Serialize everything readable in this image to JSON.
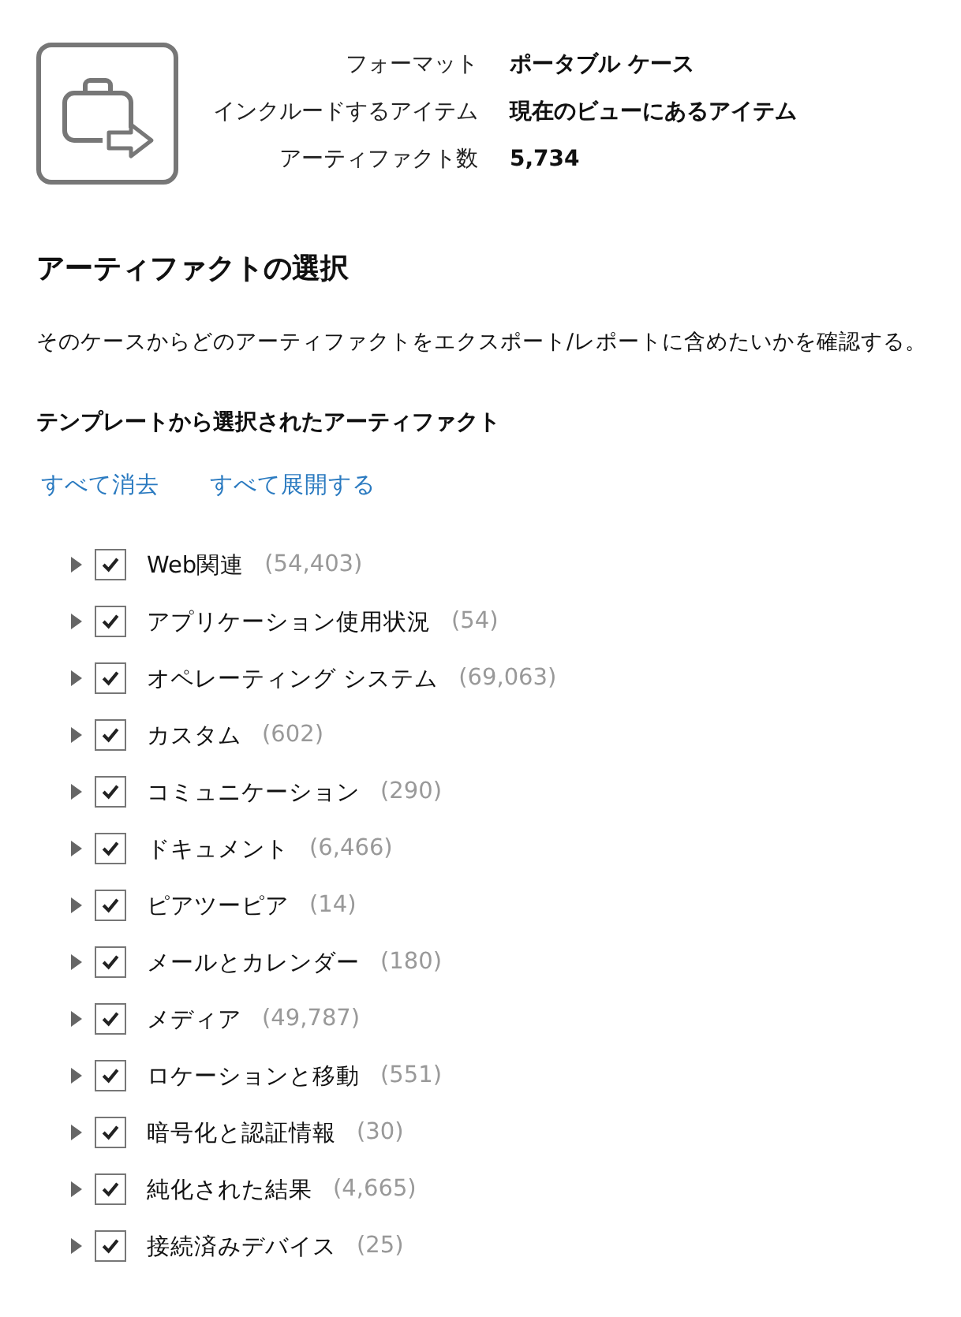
{
  "summary": [
    {
      "label": "フォーマット",
      "value": "ポータブル ケース"
    },
    {
      "label": "インクルードするアイテム",
      "value": "現在のビューにあるアイテム"
    },
    {
      "label": "アーティファクト数",
      "value": "5,734"
    }
  ],
  "section_title": "アーティファクトの選択",
  "description": "そのケースからどのアーティファクトをエクスポート/レポートに含めたいかを確認する。",
  "subtitle": "テンプレートから選択されたアーティファクト",
  "links": [
    "すべて消去",
    "すべて展開する"
  ],
  "artifacts": [
    {
      "name": "Web関連",
      "count": "(54,403)",
      "checked": true,
      "expanded": false
    },
    {
      "name": "アプリケーション使用状況",
      "count": "(54)",
      "checked": true,
      "expanded": false
    },
    {
      "name": "オペレーティング システム",
      "count": "(69,063)",
      "checked": true,
      "expanded": false
    },
    {
      "name": "カスタム",
      "count": "(602)",
      "checked": true,
      "expanded": false
    },
    {
      "name": "コミュニケーション",
      "count": "(290)",
      "checked": true,
      "expanded": false
    },
    {
      "name": "ドキュメント",
      "count": "(6,466)",
      "checked": true,
      "expanded": false
    },
    {
      "name": "ピアツーピア",
      "count": "(14)",
      "checked": true,
      "expanded": false
    },
    {
      "name": "メールとカレンダー",
      "count": "(180)",
      "checked": true,
      "expanded": false
    },
    {
      "name": "メディア",
      "count": "(49,787)",
      "checked": true,
      "expanded": false
    },
    {
      "name": "ロケーションと移動",
      "count": "(551)",
      "checked": true,
      "expanded": false
    },
    {
      "name": "暗号化と認証情報",
      "count": "(30)",
      "checked": true,
      "expanded": false
    },
    {
      "name": "純化された結果",
      "count": "(4,665)",
      "checked": true,
      "expanded": false
    },
    {
      "name": "接続済みデバイス",
      "count": "(25)",
      "checked": true,
      "expanded": false
    }
  ]
}
